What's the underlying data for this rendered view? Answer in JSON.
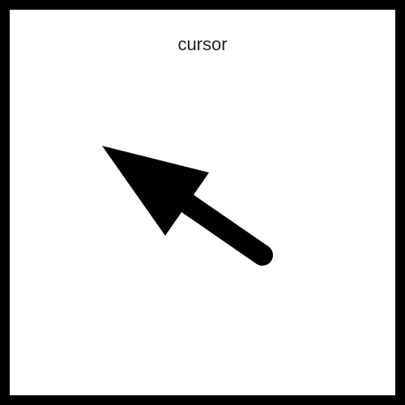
{
  "card": {
    "label": "cursor",
    "icon": "arrow-cursor-icon",
    "border_color": "#000000",
    "icon_color": "#000000"
  }
}
